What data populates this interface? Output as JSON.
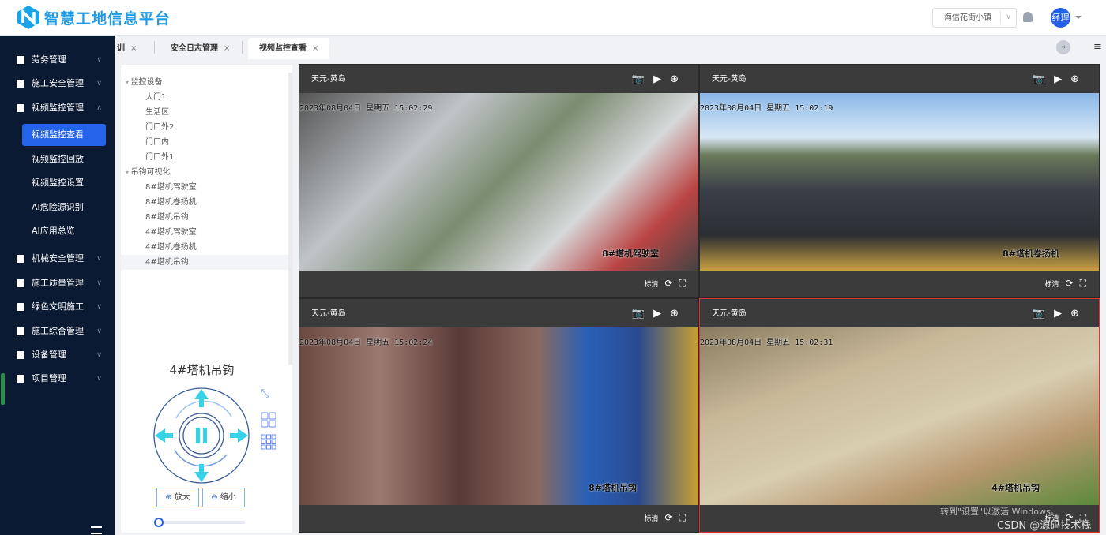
{
  "header": {
    "title": "智慧工地信息平台",
    "site": "海信花街小镇",
    "user": "经理"
  },
  "sidebar": {
    "items": [
      {
        "label": "劳务管理",
        "icon": "users-icon",
        "expanded": false
      },
      {
        "label": "施工安全管理",
        "icon": "building-icon",
        "expanded": false
      },
      {
        "label": "视频监控管理",
        "icon": "building-icon",
        "expanded": true,
        "children": [
          "视频监控查看",
          "视频监控回放",
          "视频监控设置",
          "AI危险源识别",
          "AI应用总览"
        ],
        "active": "视频监控查看"
      },
      {
        "label": "机械安全管理",
        "icon": "building-icon",
        "expanded": false
      },
      {
        "label": "施工质量管理",
        "icon": "cube-icon",
        "expanded": false
      },
      {
        "label": "绿色文明施工",
        "icon": "cube-icon",
        "expanded": false
      },
      {
        "label": "施工综合管理",
        "icon": "cube-icon",
        "expanded": false
      },
      {
        "label": "设备管理",
        "icon": "list-icon",
        "expanded": false
      },
      {
        "label": "项目管理",
        "icon": "list-icon",
        "expanded": false
      }
    ]
  },
  "tabs": [
    {
      "label": "培训"
    },
    {
      "label": "安全日志管理"
    },
    {
      "label": "视频监控查看",
      "active": true
    }
  ],
  "tree": {
    "groups": [
      {
        "label": "监控设备",
        "children": [
          "大门1",
          "生活区",
          "门口外2",
          "门口内",
          "门口外1"
        ]
      },
      {
        "label": "吊钩可视化",
        "children": [
          "8#塔机驾驶室",
          "8#塔机卷扬机",
          "8#塔机吊钩",
          "4#塔机驾驶室",
          "4#塔机卷扬机",
          "4#塔机吊钩"
        ]
      }
    ],
    "selected": "4#塔机吊钩"
  },
  "ptz": {
    "title": "4#塔机吊钩",
    "zoom_in": "放大",
    "zoom_out": "缩小",
    "speed": 0
  },
  "panels": [
    {
      "title": "天元-黄岛",
      "timestamp": "2023年08月04日 星期五 15:02:29",
      "camera": "8#塔机驾驶室",
      "footer": "标清"
    },
    {
      "title": "天元-黄岛",
      "timestamp": "2023年08月04日 星期五 15:02:19",
      "camera": "8#塔机卷扬机",
      "footer": "标清"
    },
    {
      "title": "天元-黄岛",
      "timestamp": "2023年08月04日 星期五 15:02:24",
      "camera": "8#塔机吊钩",
      "footer": "标清"
    },
    {
      "title": "天元-黄岛",
      "timestamp": "2023年08月04日 星期五 15:02:31",
      "camera": "4#塔机吊钩",
      "footer": "标清",
      "selected": true
    }
  ],
  "overlay": {
    "windows": "转到\"设置\"以激活 Windows。",
    "csdn": "CSDN @源码技术栈"
  },
  "colors": {
    "accent": "#2563eb",
    "sidebar": "#0b1a33",
    "title": "#1f9be6"
  }
}
